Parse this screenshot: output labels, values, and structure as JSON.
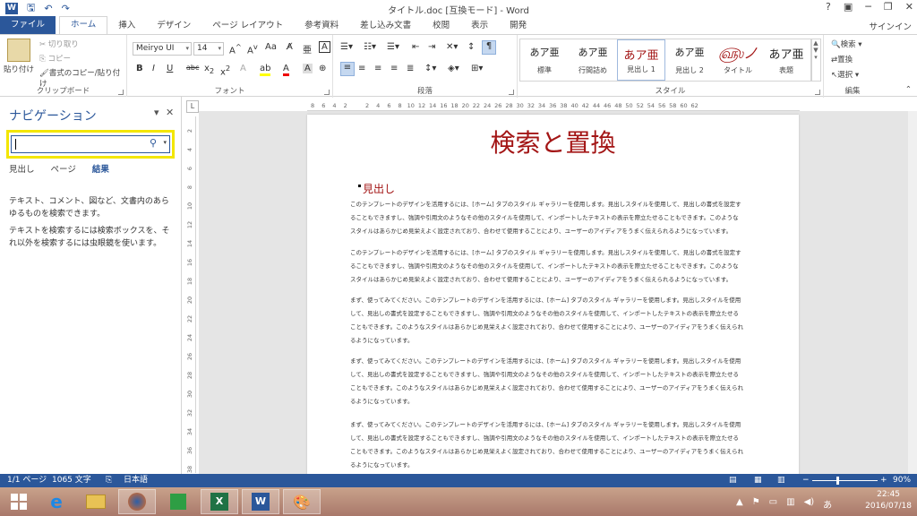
{
  "window": {
    "title": "タイトル.doc [互換モード] - Word",
    "controls": [
      "?",
      "▣",
      "─",
      "❐",
      "✕"
    ],
    "signin": "サインイン"
  },
  "qat": {
    "logo": "W",
    "undo": "↶",
    "redo": "↷",
    "save": "🖫"
  },
  "menu": {
    "file": "ファイル",
    "tabs": [
      "ホーム",
      "挿入",
      "デザイン",
      "ページ レイアウト",
      "参考資料",
      "差し込み文書",
      "校閲",
      "表示",
      "開発"
    ]
  },
  "ribbon": {
    "clipboard": {
      "paste": "貼り付け",
      "cut": "切り取り",
      "copy": "コピー",
      "format_painter": "書式のコピー/貼り付け",
      "label": "クリップボード"
    },
    "font": {
      "name": "Meiryo UI",
      "size": "14",
      "label": "フォント"
    },
    "paragraph": {
      "label": "段落"
    },
    "styles": {
      "label": "スタイル",
      "items": [
        {
          "preview": "あア亜",
          "name": "標準"
        },
        {
          "preview": "あア亜",
          "name": "行間詰め"
        },
        {
          "preview": "あア亜",
          "name": "見出し 1"
        },
        {
          "preview": "あア亜",
          "name": "見出し 2"
        },
        {
          "preview": "あア亜",
          "name": "タイトル"
        },
        {
          "preview": "あア亜",
          "name": "表題"
        }
      ]
    },
    "editing": {
      "find": "検索",
      "replace": "置換",
      "select": "選択",
      "label": "編集"
    }
  },
  "nav": {
    "title": "ナビゲーション",
    "search_value": "",
    "tabs": [
      "見出し",
      "ページ",
      "結果"
    ],
    "msg1": "テキスト、コメント、図など、文書内のあらゆるものを検索できます。",
    "msg2": "テキストを検索するには検索ボックスを、それ以外を検索するには虫眼鏡を使います。"
  },
  "ruler": {
    "h": [
      "8",
      "6",
      "4",
      "2",
      "",
      "2",
      "4",
      "6",
      "8",
      "10",
      "12",
      "14",
      "16",
      "18",
      "20",
      "22",
      "24",
      "26",
      "28",
      "30",
      "32",
      "34",
      "36",
      "38",
      "40",
      "42",
      "44",
      "46",
      "48",
      "50",
      "52",
      "54",
      "56",
      "58",
      "60",
      "62"
    ],
    "v": [
      "2",
      "4",
      "6",
      "8",
      "10",
      "12",
      "14",
      "16",
      "18",
      "20",
      "22",
      "24",
      "26",
      "28",
      "30",
      "32",
      "34",
      "36",
      "38"
    ]
  },
  "doc": {
    "title": "検索と置換",
    "heading": "見出し",
    "p1": "このテンプレートのデザインを活用するには、[ホーム] タブのスタイル ギャラリーを使用します。見出しスタイルを使用して、見出しの書式を設定することもできますし、強調や引用文のようなその他のスタイルを使用して、インポートしたテキストの表示を際立たせることもできます。このようなスタイルはあらかじめ見栄えよく設定されており、合わせて使用することにより、ユーザーのアイディアをうまく伝えられるようになっています。",
    "p2": "このテンプレートのデザインを活用するには、[ホーム] タブのスタイル ギャラリーを使用します。見出しスタイルを使用して、見出しの書式を設定することもできますし、強調や引用文のようなその他のスタイルを使用して、インポートしたテキストの表示を際立たせることもできます。このようなスタイルはあらかじめ見栄えよく設定されており、合わせて使用することにより、ユーザーのアイディアをうまく伝えられるようになっています。",
    "p3": "まず、使ってみてください。このテンプレートのデザインを活用するには、[ホーム] タブのスタイル ギャラリーを使用します。見出しスタイルを使用して、見出しの書式を設定することもできますし、強調や引用文のようなその他のスタイルを使用して、インポートしたテキストの表示を際立たせることもできます。このようなスタイルはあらかじめ見栄えよく設定されており、合わせて使用することにより、ユーザーのアイディアをうまく伝えられるようになっています。",
    "p4": "まず、使ってみてください。このテンプレートのデザインを活用するには、[ホーム] タブのスタイル ギャラリーを使用します。見出しスタイルを使用して、見出しの書式を設定することもできますし、強調や引用文のようなその他のスタイルを使用して、インポートしたテキストの表示を際立たせることもできます。このようなスタイルはあらかじめ見栄えよく設定されており、合わせて使用することにより、ユーザーのアイディアをうまく伝えられるようになっています。",
    "p5": "まず、使ってみてください。このテンプレートのデザインを活用するには、[ホーム] タブのスタイル ギャラリーを使用します。見出しスタイルを使用して、見出しの書式を設定することもできますし、強調や引用文のようなその他のスタイルを使用して、インポートしたテキストの表示を際立たせることもできます。このようなスタイルはあらかじめ見栄えよく設定されており、合わせて使用することにより、ユーザーのアイディアをうまく伝えられるようになっています。"
  },
  "status": {
    "page": "1/1 ページ",
    "words": "1065 文字",
    "lang": "日本語",
    "zoom": "90%"
  },
  "tray": {
    "time": "22:45",
    "date": "2016/07/18",
    "ime": "あ"
  },
  "colors": {
    "accent": "#2b579a",
    "heading": "#a31515",
    "highlight": "#f3e600"
  }
}
